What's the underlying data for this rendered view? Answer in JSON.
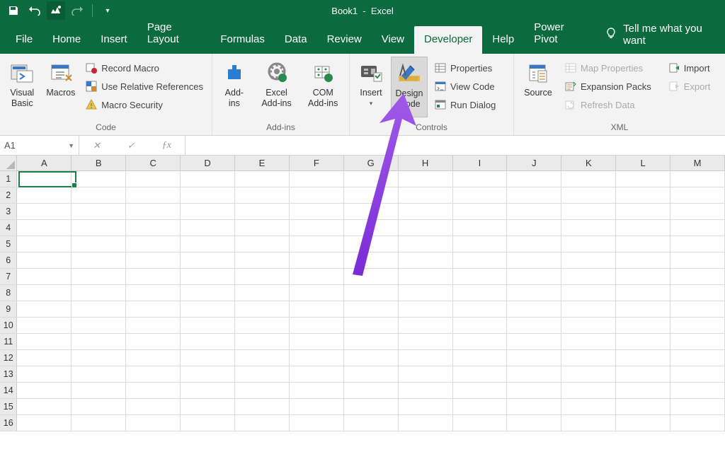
{
  "titlebar": {
    "title": "Book1  -  Excel"
  },
  "tabs": {
    "file": "File",
    "home": "Home",
    "insert": "Insert",
    "page_layout": "Page Layout",
    "formulas": "Formulas",
    "data": "Data",
    "review": "Review",
    "view": "View",
    "developer": "Developer",
    "help": "Help",
    "power_pivot": "Power Pivot",
    "tell_me": "Tell me what you want"
  },
  "ribbon": {
    "code": {
      "label": "Code",
      "visual_basic": "Visual\nBasic",
      "macros": "Macros",
      "record_macro": "Record Macro",
      "use_relative": "Use Relative References",
      "macro_security": "Macro Security"
    },
    "addins": {
      "label": "Add-ins",
      "addins": "Add-\nins",
      "excel_addins": "Excel\nAdd-ins",
      "com_addins": "COM\nAdd-ins"
    },
    "controls": {
      "label": "Controls",
      "insert": "Insert",
      "design_mode": "Design\nMode",
      "properties": "Properties",
      "view_code": "View Code",
      "run_dialog": "Run Dialog"
    },
    "xml": {
      "label": "XML",
      "source": "Source",
      "map_properties": "Map Properties",
      "expansion_packs": "Expansion Packs",
      "refresh_data": "Refresh Data",
      "import": "Import",
      "export": "Export"
    }
  },
  "namebox": {
    "value": "A1"
  },
  "columns": [
    "A",
    "B",
    "C",
    "D",
    "E",
    "F",
    "G",
    "H",
    "I",
    "J",
    "K",
    "L",
    "M"
  ],
  "rows": [
    "1",
    "2",
    "3",
    "4",
    "5",
    "6",
    "7",
    "8",
    "9",
    "10",
    "11",
    "12",
    "13",
    "14",
    "15",
    "16"
  ]
}
